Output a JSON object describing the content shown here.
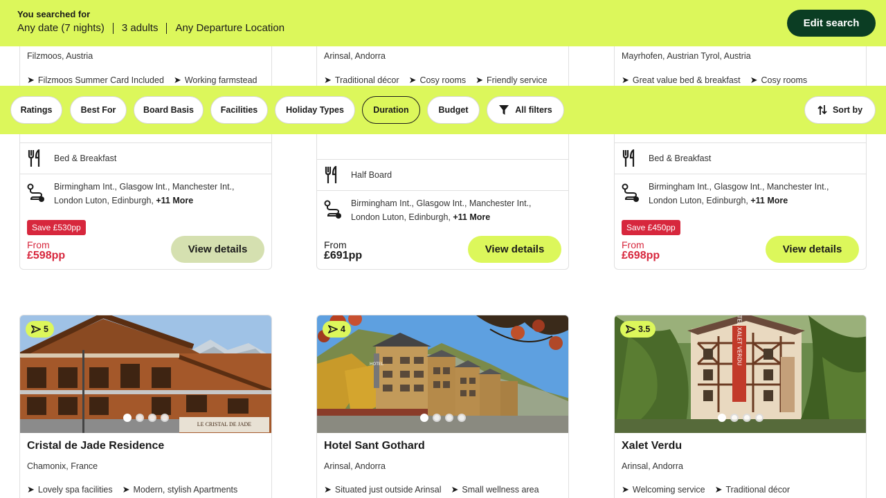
{
  "summary": {
    "title": "You searched for",
    "date": "Any date (7 nights)",
    "adults": "3 adults",
    "departure": "Any Departure Location",
    "edit_label": "Edit search"
  },
  "filters": {
    "chips": [
      "Ratings",
      "Best For",
      "Board Basis",
      "Facilities",
      "Holiday Types",
      "Duration",
      "Budget"
    ],
    "active": "Duration",
    "all_filters_label": "All filters",
    "sort_label": "Sort by"
  },
  "top_cards": [
    {
      "location": "Filzmoos, Austria",
      "features": [
        "Filzmoos Summer Card Included",
        "Working farmstead"
      ],
      "board": "Bed & Breakfast",
      "airports_line1": "Birmingham Int., Glasgow Int., Manchester Int.,",
      "airports_line2": "London Luton, Edinburgh,",
      "more": "+11 More",
      "save": "Save £530pp",
      "from": "From",
      "price": "£598pp",
      "view_label": "View details"
    },
    {
      "location": "Arinsal, Andorra",
      "features": [
        "Traditional décor",
        "Cosy rooms",
        "Friendly service"
      ],
      "board": "Half Board",
      "airports_line1": "Birmingham Int., Glasgow Int., Manchester Int.,",
      "airports_line2": "London Luton, Edinburgh,",
      "more": "+11 More",
      "save": "",
      "from": "From",
      "price": "£691pp",
      "view_label": "View details"
    },
    {
      "location": "Mayrhofen, Austrian Tyrol, Austria",
      "features": [
        "Great value bed & breakfast",
        "Cosy rooms"
      ],
      "board": "Bed & Breakfast",
      "airports_line1": "Birmingham Int., Glasgow Int., Manchester Int.,",
      "airports_line2": "London Luton, Edinburgh,",
      "more": "+11 More",
      "save": "Save £450pp",
      "from": "From",
      "price": "£698pp",
      "view_label": "View details"
    }
  ],
  "bottom_cards": [
    {
      "rating": "5",
      "name": "Cristal de Jade Residence",
      "location": "Chamonix, France",
      "features": [
        "Lovely spa facilities",
        "Modern, stylish Apartments"
      ],
      "photo_sign": "LE CRISTAL DE JADE"
    },
    {
      "rating": "4",
      "name": "Hotel Sant Gothard",
      "location": "Arinsal, Andorra",
      "features": [
        "Situated just outside Arinsal",
        "Small wellness area"
      ],
      "photo_sign": "HOTEL"
    },
    {
      "rating": "3.5",
      "name": "Xalet Verdu",
      "location": "Arinsal, Andorra",
      "features": [
        "Welcoming service",
        "Traditional décor"
      ],
      "photo_sign": "HOTEL XALET VERDU"
    }
  ],
  "colors": {
    "brand_lime": "#dcf75b",
    "brand_dark_green": "#0b3d23",
    "save_red": "#d7273d"
  }
}
